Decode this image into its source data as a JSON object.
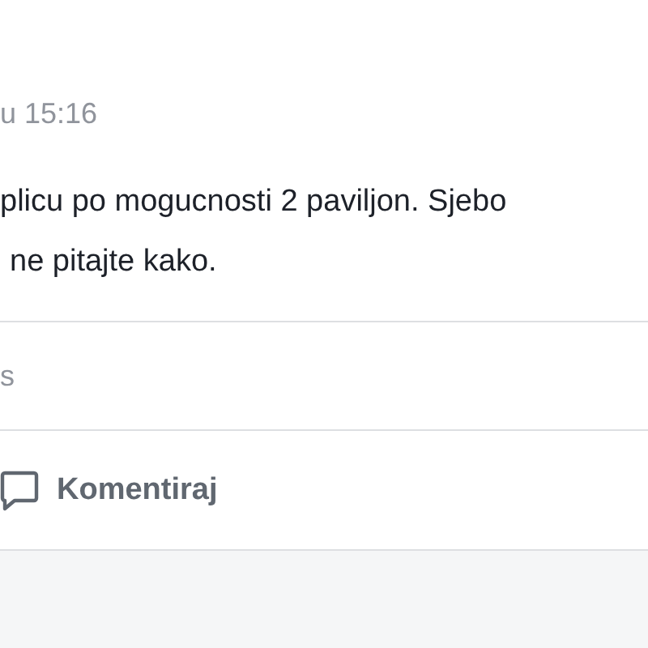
{
  "post": {
    "timestamp": "u 15:16",
    "text_lines": [
      "plicu po mogucnosti 2 paviljon. Sjebo",
      "ne pitajte kako."
    ],
    "stats": "s",
    "actions": [
      {
        "kind": "comment",
        "label": "Komentiraj"
      }
    ]
  }
}
